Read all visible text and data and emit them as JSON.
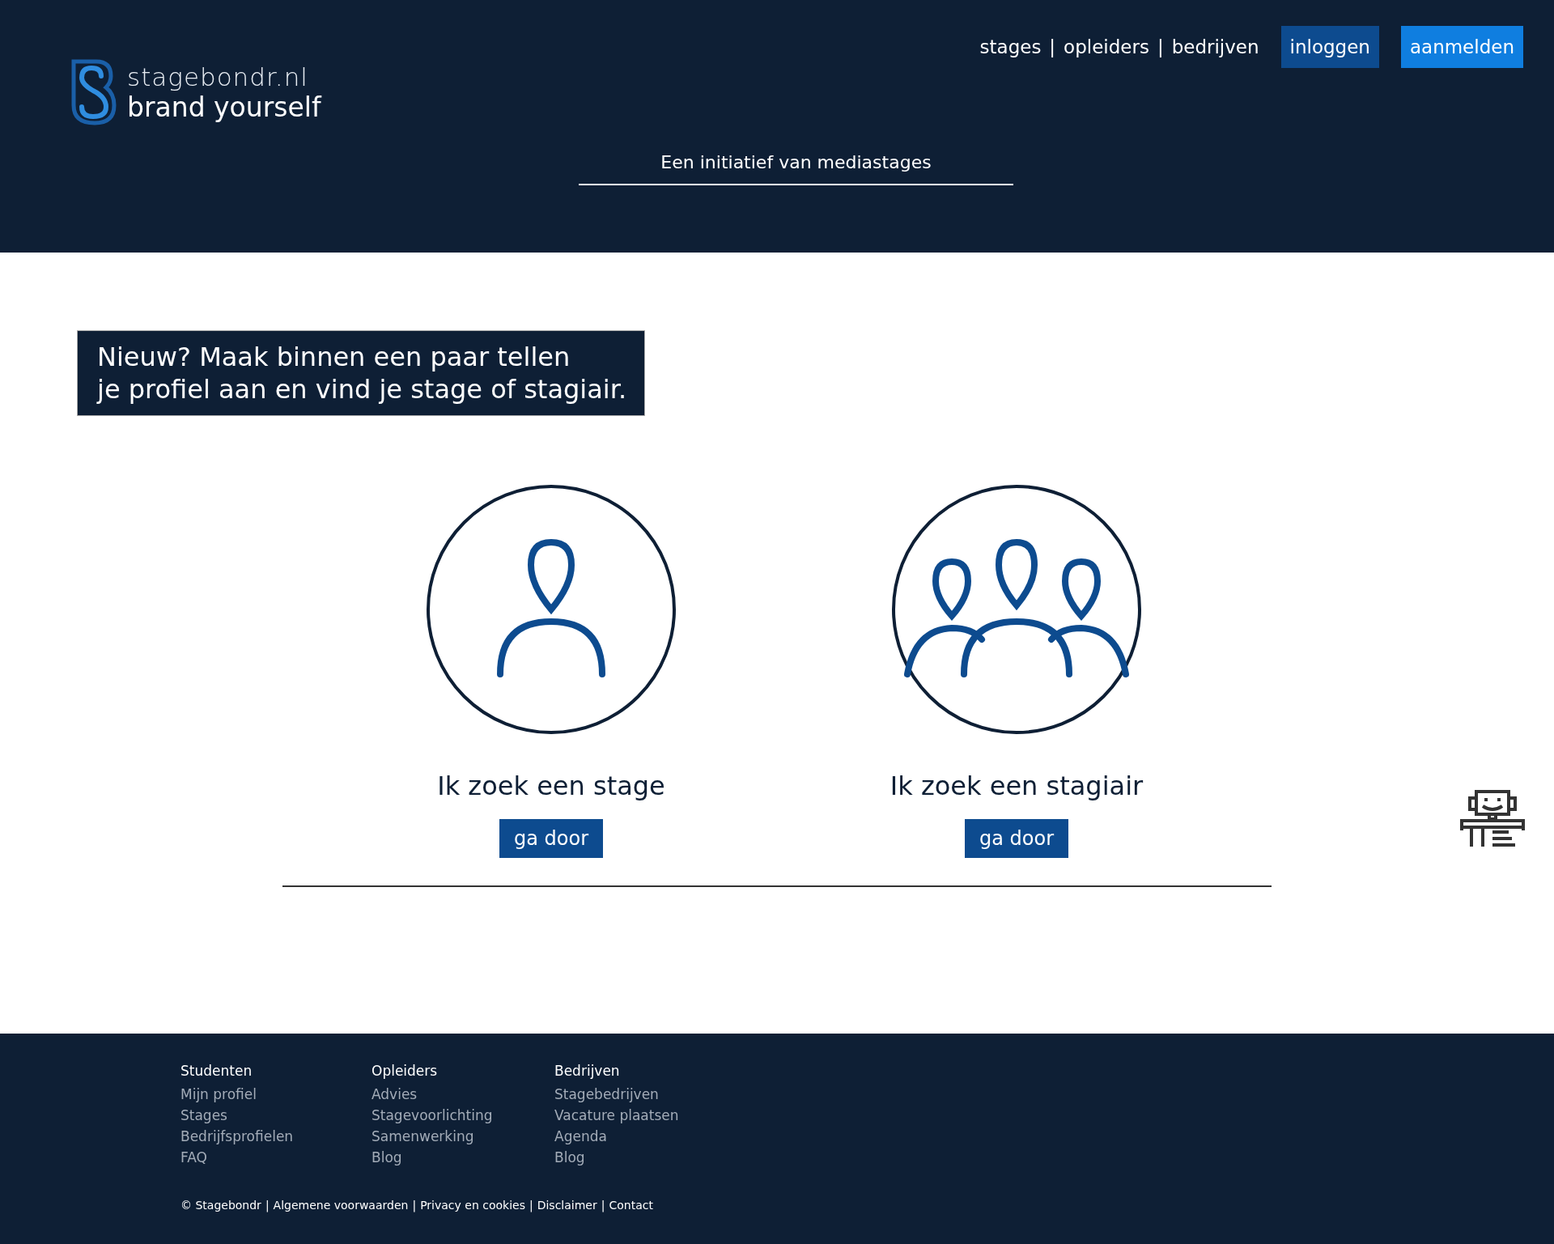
{
  "header": {
    "logo": {
      "name": "stagebondr.nl",
      "slogan": "brand yourself"
    },
    "nav": {
      "separator": "|",
      "links": [
        "stages",
        "opleiders",
        "bedrijven"
      ]
    },
    "buttons": [
      {
        "label": "inloggen",
        "kind": "secondary"
      },
      {
        "label": "aanmelden",
        "kind": "primary"
      }
    ],
    "tagline": "Een initiatief van mediastages"
  },
  "callout": [
    "Nieuw? Maak binnen een paar tellen",
    "je profiel aan en vind je stage of stagiair."
  ],
  "choices": [
    {
      "kind": "single",
      "title": "Ik zoek een stage",
      "button": "ga door"
    },
    {
      "kind": "group",
      "title": "Ik zoek een stagiair",
      "button": "ga door"
    }
  ],
  "footer": {
    "columns": [
      {
        "heading": "Studenten",
        "links": [
          "Mijn profiel",
          "Stages",
          "Bedrijfsprofielen",
          "FAQ"
        ]
      },
      {
        "heading": "Opleiders",
        "links": [
          "Advies",
          "Stagevoorlichting",
          "Samenwerking",
          "Blog"
        ]
      },
      {
        "heading": "Bedrijven",
        "links": [
          "Stagebedrijven",
          "Vacature plaatsen",
          "Agenda",
          "Blog"
        ]
      }
    ],
    "legal": {
      "separator": "|",
      "items": [
        "© Stagebondr",
        "Algemene voorwaarden",
        "Privacy en cookies",
        "Disclaimer",
        "Contact"
      ]
    }
  }
}
